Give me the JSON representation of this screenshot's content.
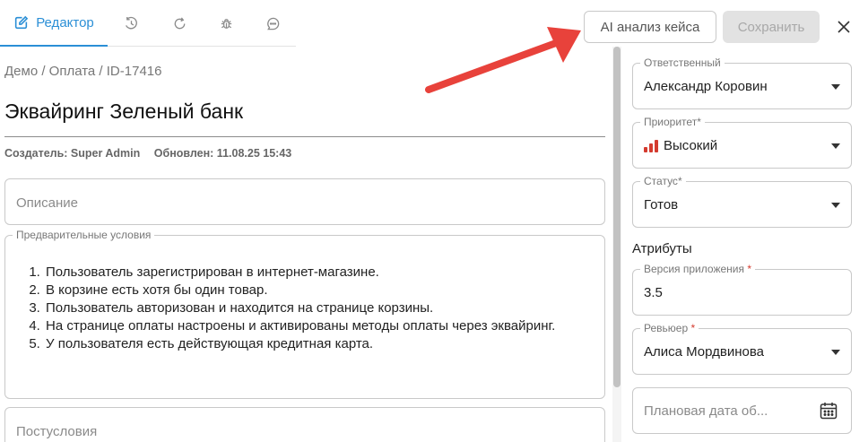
{
  "tabs": {
    "editor_label": "Редактор",
    "icons": [
      "edit-icon",
      "history-icon",
      "refresh-icon",
      "bug-icon",
      "comment-icon"
    ]
  },
  "breadcrumb": "Демо / Оплата / ID-17416",
  "title": "Эквайринг Зеленый банк",
  "meta": {
    "creator": "Создатель: Super Admin",
    "updated": "Обновлен: 11.08.25 15:43"
  },
  "description": {
    "placeholder": "Описание"
  },
  "preconditions": {
    "label": "Предварительные условия",
    "items": [
      "Пользователь зарегистрирован в интернет-магазине.",
      "В корзине есть хотя бы один товар.",
      "Пользователь авторизован и находится на странице корзины.",
      "На странице оплаты настроены и активированы методы оплаты через эквайринг.",
      "У пользователя есть действующая кредитная карта."
    ]
  },
  "postconditions": {
    "placeholder": "Постусловия"
  },
  "actions": {
    "ai_label": "AI анализ кейса",
    "save_label": "Сохранить"
  },
  "sidebar": {
    "responsible": {
      "label": "Ответственный",
      "value": "Александр Коровин"
    },
    "priority": {
      "label": "Приоритет",
      "required_mark": "*",
      "value": "Высокий",
      "color": "#d43b2f"
    },
    "status": {
      "label": "Статус",
      "required_mark": "*",
      "value": "Готов"
    },
    "attributes_title": "Атрибуты",
    "app_version": {
      "label": "Версия приложения",
      "required_mark": "*",
      "value": "3.5"
    },
    "reviewer": {
      "label": "Ревьюер",
      "required_mark": "*",
      "value": "Алиса Мордвинова"
    },
    "planned_date": {
      "placeholder": "Плановая дата об..."
    }
  },
  "colors": {
    "accent": "#2b8fd6",
    "required": "#d43b2f",
    "arrow": "#e8423b"
  }
}
